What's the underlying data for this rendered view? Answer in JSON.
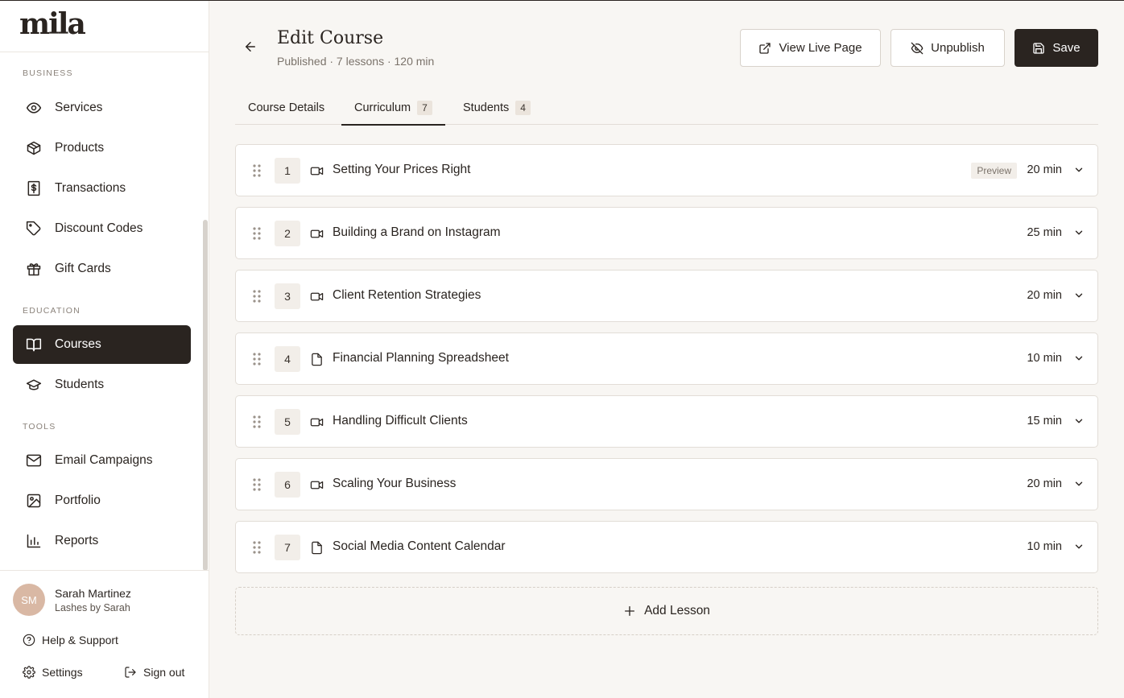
{
  "brand": {
    "logo_text": "mila"
  },
  "sidebar": {
    "sections": [
      {
        "label": "BUSINESS"
      },
      {
        "label": "EDUCATION"
      },
      {
        "label": "TOOLS"
      }
    ],
    "items": [
      {
        "label": "Services",
        "icon": "eye-icon"
      },
      {
        "label": "Products",
        "icon": "box-icon"
      },
      {
        "label": "Transactions",
        "icon": "receipt-dollar-icon"
      },
      {
        "label": "Discount Codes",
        "icon": "tag-icon"
      },
      {
        "label": "Gift Cards",
        "icon": "gift-icon"
      },
      {
        "label": "Courses",
        "icon": "open-book-icon",
        "active": true
      },
      {
        "label": "Students",
        "icon": "graduation-cap-icon"
      },
      {
        "label": "Email Campaigns",
        "icon": "mail-icon"
      },
      {
        "label": "Portfolio",
        "icon": "image-icon"
      },
      {
        "label": "Reports",
        "icon": "bar-chart-icon"
      }
    ]
  },
  "user": {
    "initials": "SM",
    "name": "Sarah Martinez",
    "business": "Lashes by Sarah"
  },
  "footer": {
    "help": "Help & Support",
    "settings": "Settings",
    "signout": "Sign out"
  },
  "header": {
    "title": "Edit Course",
    "subtitle": "Published · 7 lessons · 120 min",
    "view_live": "View Live Page",
    "unpublish": "Unpublish",
    "save": "Save"
  },
  "tabs": [
    {
      "label": "Course Details",
      "count": null
    },
    {
      "label": "Curriculum",
      "count": "7",
      "active": true
    },
    {
      "label": "Students",
      "count": "4"
    }
  ],
  "lessons": [
    {
      "num": "1",
      "type": "video",
      "title": "Setting Your Prices Right",
      "badge": "Preview",
      "duration": "20 min"
    },
    {
      "num": "2",
      "type": "video",
      "title": "Building a Brand on Instagram",
      "duration": "25 min"
    },
    {
      "num": "3",
      "type": "video",
      "title": "Client Retention Strategies",
      "duration": "20 min"
    },
    {
      "num": "4",
      "type": "document",
      "title": "Financial Planning Spreadsheet",
      "duration": "10 min"
    },
    {
      "num": "5",
      "type": "video",
      "title": "Handling Difficult Clients",
      "duration": "15 min"
    },
    {
      "num": "6",
      "type": "video",
      "title": "Scaling Your Business",
      "duration": "20 min"
    },
    {
      "num": "7",
      "type": "document",
      "title": "Social Media Content Calendar",
      "duration": "10 min"
    }
  ],
  "add_lesson": "Add Lesson",
  "colors": {
    "dark": "#2a2420",
    "background": "#f8f6f3",
    "avatar": "#d9b8a4"
  }
}
